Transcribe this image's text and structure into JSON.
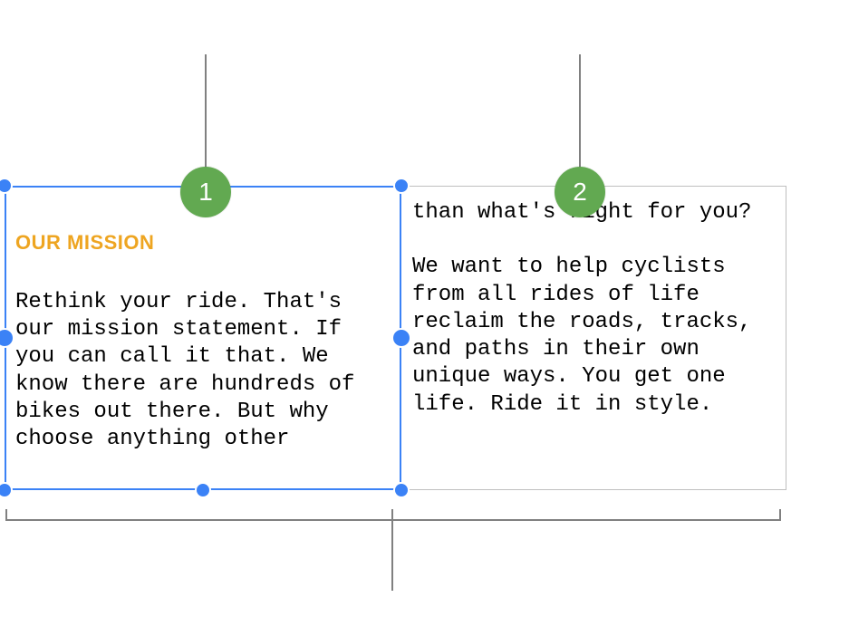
{
  "callouts": {
    "badge1": "1",
    "badge2": "2",
    "badge_color": "#62a951"
  },
  "colors": {
    "selection_blue": "#3b82f6",
    "heading_accent": "#eea521",
    "border_gray": "#bfbfbf"
  },
  "textbox1": {
    "heading": "OUR MISSION",
    "body": "Rethink your ride. That's our mission statement. If you can call it that. We know there are hundreds of bikes out there. But why choose anything other"
  },
  "textbox2": {
    "body": "than what's right for you?\n\nWe want to help cyclists from all rides of life reclaim the roads, tracks, and paths in their own unique ways. You get one life. Ride it in style."
  }
}
